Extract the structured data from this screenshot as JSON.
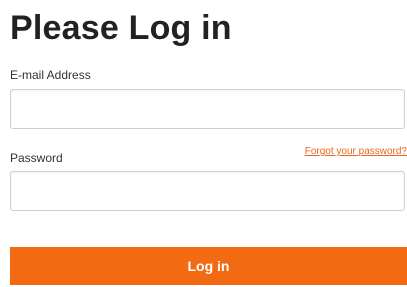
{
  "login_form": {
    "title": "Please Log in",
    "email": {
      "label": "E-mail Address",
      "value": "",
      "placeholder": ""
    },
    "password": {
      "label": "Password",
      "value": "",
      "placeholder": ""
    },
    "forgot_password_link": "Forgot your password?",
    "submit_label": "Log in",
    "accent_color": "#f26a12",
    "link_color": "#e8671e"
  }
}
